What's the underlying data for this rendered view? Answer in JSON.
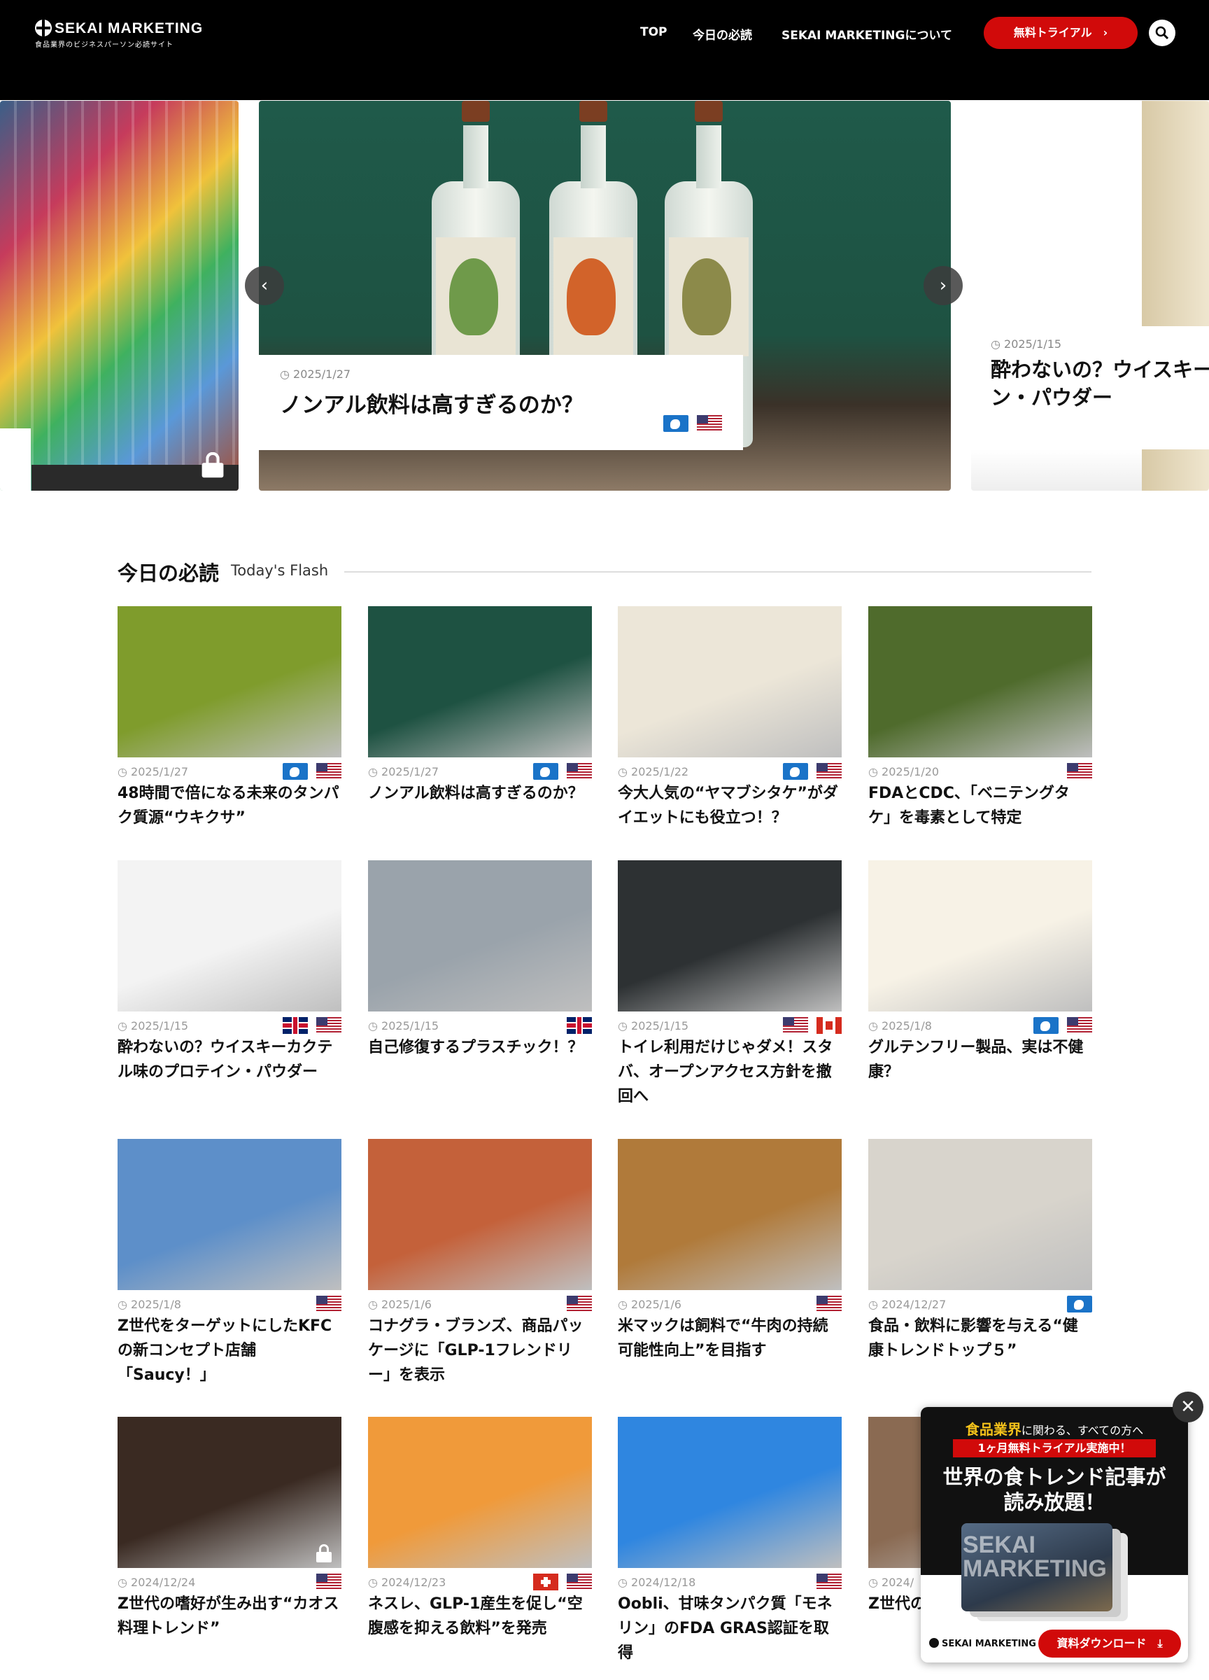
{
  "header": {
    "logo": "SEKAI MARKETING",
    "tagline": "食品業界のビジネスパーソン必読サイト",
    "nav": [
      "TOP",
      "今日の必読",
      "SEKAI MARKETINGについて"
    ],
    "trial_button": "無料トライアル　›",
    "search_icon": "search-icon"
  },
  "hero": {
    "main": {
      "date": "2025/1/27",
      "title": "ノンアル飲料は高すぎるのか？",
      "flags": [
        "world",
        "us"
      ]
    },
    "right": {
      "date": "2025/1/15",
      "title_line1": "酔わないの？ウイスキーカ",
      "title_line2": "ン・パウダー"
    },
    "prev_arrow": "‹",
    "next_arrow": "›"
  },
  "section": {
    "title": "今日の必読",
    "subtitle": "Today's Flash"
  },
  "articles": [
    {
      "date": "2025/1/27",
      "flags": [
        "world",
        "us"
      ],
      "title": "48時間で倍になる未来のタンパク質源“ウキクサ”",
      "bg": "#7f9c2c"
    },
    {
      "date": "2025/1/27",
      "flags": [
        "world",
        "us"
      ],
      "title": "ノンアル飲料は高すぎるのか？",
      "bg": "#1e5242"
    },
    {
      "date": "2025/1/22",
      "flags": [
        "world",
        "us"
      ],
      "title": "今大人気の“ヤマブシタケ”がダイエットにも役立つ！？",
      "bg": "#ece6d8"
    },
    {
      "date": "2025/1/20",
      "flags": [
        "us"
      ],
      "title": "FDAとCDC、「ベニテングタケ」を毒素として特定",
      "bg": "#4f6b2c"
    },
    {
      "date": "2025/1/15",
      "flags": [
        "uk",
        "us"
      ],
      "title": "酔わないの？ウイスキーカクテル味のプロテイン・パウダー",
      "bg": "#f3f3f3"
    },
    {
      "date": "2025/1/15",
      "flags": [
        "uk"
      ],
      "title": "自己修復するプラスチック！？",
      "bg": "#9aa3ab"
    },
    {
      "date": "2025/1/15",
      "flags": [
        "us",
        "ca"
      ],
      "title": "トイレ利用だけじゃダメ！スタバ、オープンアクセス方針を撤回へ",
      "bg": "#2d3133"
    },
    {
      "date": "2025/1/8",
      "flags": [
        "world",
        "us"
      ],
      "title": "グルテンフリー製品、実は不健康？",
      "bg": "#f7f2e6"
    },
    {
      "date": "2025/1/8",
      "flags": [
        "us"
      ],
      "title": "Z世代をターゲットにしたKFCの新コンセプト店舗「Saucy！」",
      "bg": "#5d8fc9"
    },
    {
      "date": "2025/1/6",
      "flags": [
        "us"
      ],
      "title": "コナグラ・ブランズ、商品パッケージに「GLP-1フレンドリー」を表示",
      "bg": "#c4613a"
    },
    {
      "date": "2025/1/6",
      "flags": [
        "us"
      ],
      "title": "米マックは飼料で“牛肉の持続可能性向上”を目指す",
      "bg": "#b07a3a"
    },
    {
      "date": "2024/12/27",
      "flags": [
        "world"
      ],
      "title": "食品・飲料に影響を与える“健康トレンドトップ５”",
      "bg": "#d8d4cc"
    },
    {
      "date": "2024/12/24",
      "flags": [
        "us"
      ],
      "title": "Z世代の嗜好が生み出す“カオス料理トレンド”",
      "bg": "#3a2a22",
      "locked": true
    },
    {
      "date": "2024/12/23",
      "flags": [
        "ch",
        "us"
      ],
      "title": "ネスレ、GLP-1産生を促し“空腹感を抑える飲料”を発売",
      "bg": "#f09a3a"
    },
    {
      "date": "2024/12/18",
      "flags": [
        "us"
      ],
      "title": "Oobli、甘味タンパク質「モネリン」のFDA GRAS認証を取得",
      "bg": "#2f86e0"
    },
    {
      "date": "2024/",
      "flags": [],
      "title": "Z世代の背景",
      "bg": "#8a6a52"
    }
  ],
  "popup": {
    "line1_accent": "食品業界",
    "line1_rest": "に関わる、すべての方へ",
    "red_banner": "1ヶ月無料トライアル実施中！",
    "headline_1": "世界の食トレンド記事が",
    "headline_2": "読み放題！",
    "device_text_1": "SEKAI",
    "device_text_2": "MARKETING",
    "logo": "SEKAI MARKETING",
    "download_button": "資料ダウンロード　⤓",
    "close": "✕"
  }
}
